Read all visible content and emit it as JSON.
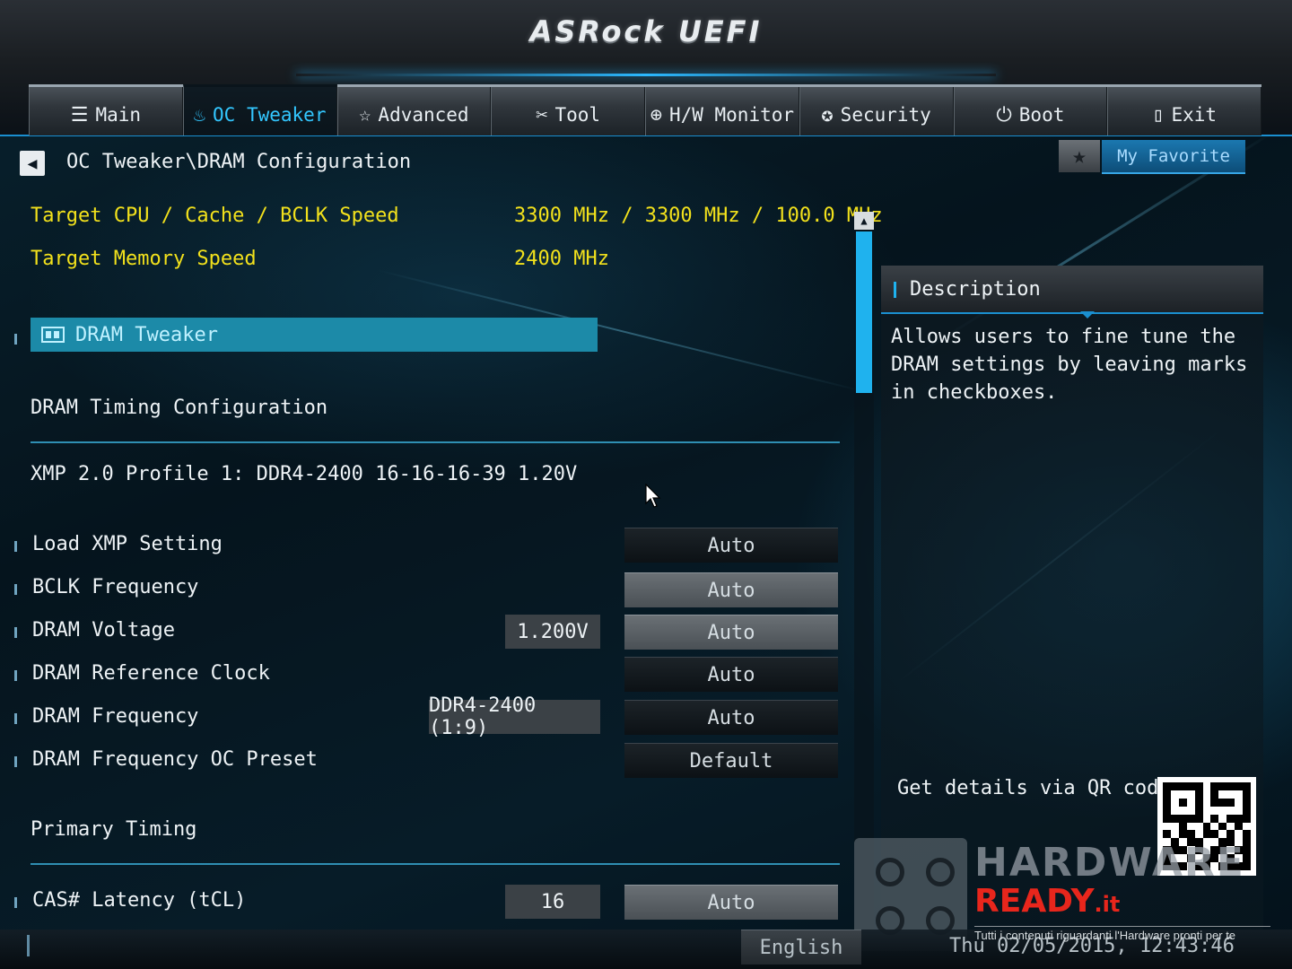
{
  "header": {
    "logo_text": "ASRock UEFI",
    "tabs": [
      {
        "label": "Main",
        "icon": "list-icon",
        "glyph": "☰",
        "active": false
      },
      {
        "label": "OC Tweaker",
        "icon": "flame-icon",
        "glyph": "♨",
        "active": true
      },
      {
        "label": "Advanced",
        "icon": "star-outline-icon",
        "glyph": "☆",
        "active": false
      },
      {
        "label": "Tool",
        "icon": "tools-icon",
        "glyph": "✂",
        "active": false
      },
      {
        "label": "H/W Monitor",
        "icon": "crosshair-icon",
        "glyph": "⊕",
        "active": false
      },
      {
        "label": "Security",
        "icon": "shield-icon",
        "glyph": "✪",
        "active": false
      },
      {
        "label": "Boot",
        "icon": "power-icon",
        "glyph": "⏻",
        "active": false
      },
      {
        "label": "Exit",
        "icon": "exit-door-icon",
        "glyph": "▯",
        "active": false
      }
    ]
  },
  "breadcrumb": "OC Tweaker\\DRAM Configuration",
  "favorite": {
    "label": "My Favorite",
    "star_glyph": "★"
  },
  "info": [
    {
      "label": "Target CPU / Cache / BCLK Speed",
      "value": "3300 MHz / 3300 MHz / 100.0 MHz"
    },
    {
      "label": "Target Memory Speed",
      "value": "2400 MHz"
    }
  ],
  "dram_tweaker": {
    "label": "DRAM Tweaker"
  },
  "sections": {
    "timing_config": "DRAM Timing Configuration",
    "xmp_profile": "XMP 2.0 Profile 1: DDR4-2400 16-16-16-39 1.20V",
    "primary_timing": "Primary Timing"
  },
  "settings": [
    {
      "label": "Load XMP Setting",
      "option": "Auto",
      "current": ""
    },
    {
      "label": "BCLK Frequency",
      "option": "Auto",
      "current": ""
    },
    {
      "label": "DRAM Voltage",
      "option": "Auto",
      "current": "1.200V"
    },
    {
      "label": "DRAM Reference Clock",
      "option": "Auto",
      "current": ""
    },
    {
      "label": "DRAM Frequency",
      "option": "Auto",
      "current": "DDR4-2400 (1:9)"
    },
    {
      "label": "DRAM Frequency OC Preset",
      "option": "Default",
      "current": ""
    },
    {
      "label": "CAS# Latency (tCL)",
      "option": "Auto",
      "current": "16"
    }
  ],
  "scrollbar": {
    "up_glyph": "▲",
    "position_fraction": 0.0
  },
  "description": {
    "title": "Description",
    "body": "Allows users to fine tune the DRAM settings by leaving marks in checkboxes.",
    "qr_label": "Get details via QR code"
  },
  "watermark": {
    "line1": "HARDWARE",
    "line2": "READY",
    "suffix": ".it",
    "tagline": "Tutti i contenuti riguardanti l'Hardware pronti per te"
  },
  "footer": {
    "language": "English",
    "datetime": "Thu 02/05/2015, 12:43:46"
  },
  "colors": {
    "accent": "#1fb2ee",
    "highlight": "#1c8aa8",
    "info_text": "#f2e11c",
    "watermark_red": "#e8261c"
  }
}
